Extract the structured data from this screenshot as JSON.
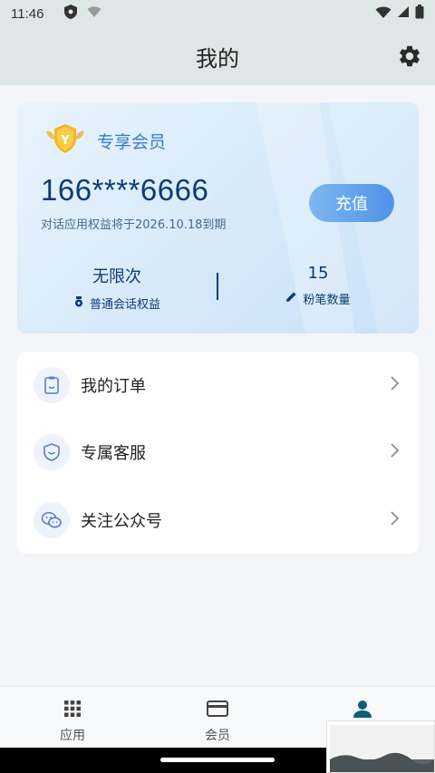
{
  "status_bar": {
    "time": "11:46"
  },
  "header": {
    "title": "我的",
    "settings_icon": "gear-icon"
  },
  "member_card": {
    "badge_label": "专享会员",
    "phone": "166****6666",
    "expire_text": "对话应用权益将于2026.10.18到期",
    "recharge_label": "充值",
    "stats": [
      {
        "value": "无限次",
        "label": "普通会话权益",
        "icon": "medal-icon"
      },
      {
        "value": "15",
        "label": "粉笔数量",
        "icon": "pencil-icon"
      }
    ]
  },
  "menu": {
    "items": [
      {
        "label": "我的订单",
        "icon": "order-icon"
      },
      {
        "label": "专属客服",
        "icon": "support-icon"
      },
      {
        "label": "关注公众号",
        "icon": "wechat-icon"
      }
    ]
  },
  "tab_bar": {
    "tabs": [
      {
        "label": "应用",
        "icon": "grid-icon"
      },
      {
        "label": "会员",
        "icon": "card-icon"
      },
      {
        "label": "",
        "icon": "person-icon",
        "active": true
      }
    ]
  },
  "colors": {
    "accent": "#0e3b73",
    "button_blue": "#4f93e6",
    "header_bg": "#dfe6e6",
    "active_tab": "#0b5f73"
  }
}
